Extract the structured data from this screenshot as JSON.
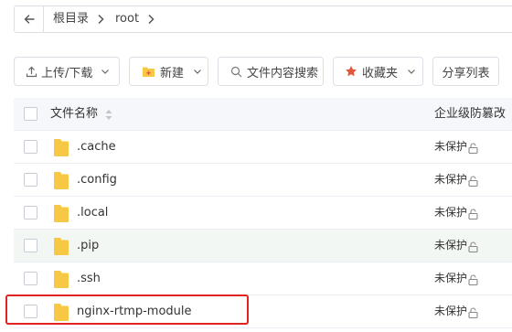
{
  "breadcrumb": {
    "items": [
      "根目录",
      "root"
    ]
  },
  "toolbar": {
    "upload_download": "上传/下载",
    "new": "新建",
    "search_content": "文件内容搜索",
    "favorites": "收藏夹",
    "share_list": "分享列表"
  },
  "table": {
    "col_name": "文件名称",
    "col_protection": "企业级防篡改",
    "rows": [
      {
        "name": ".cache",
        "status": "未保护"
      },
      {
        "name": ".config",
        "status": "未保护"
      },
      {
        "name": ".local",
        "status": "未保护"
      },
      {
        "name": ".pip",
        "status": "未保护"
      },
      {
        "name": ".ssh",
        "status": "未保护"
      },
      {
        "name": "nginx-rtmp-module",
        "status": "未保护"
      }
    ]
  },
  "colors": {
    "folder": "#f7c843",
    "highlight": "#e02424",
    "accent_red": "#e2563b"
  }
}
